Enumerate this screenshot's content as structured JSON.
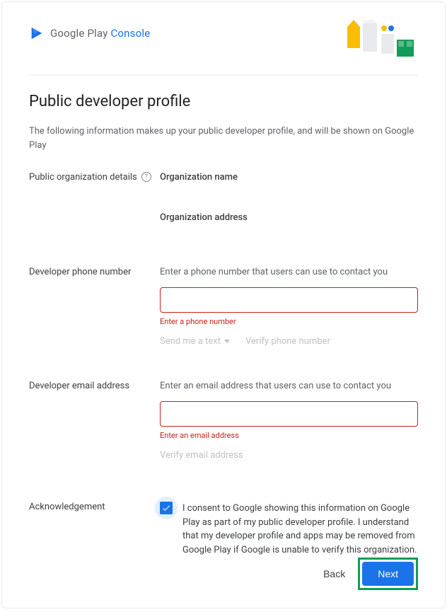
{
  "header": {
    "logo_brand": "Google Play",
    "logo_product": " Console"
  },
  "page": {
    "title": "Public developer profile",
    "description": "The following information makes up your public developer profile, and will be shown on Google Play"
  },
  "org": {
    "section_label": "Public organization details",
    "name_label": "Organization name",
    "address_label": "Organization address"
  },
  "phone": {
    "section_label": "Developer phone number",
    "hint": "Enter a phone number that users can use to contact you",
    "value": "",
    "error": "Enter a phone number",
    "send_text": "Send me a text",
    "verify": "Verify phone number"
  },
  "email": {
    "section_label": "Developer email address",
    "hint": "Enter an email address that users can use to contact you",
    "value": "",
    "error": "Enter an email address",
    "verify": "Verify email address"
  },
  "ack": {
    "section_label": "Acknowledgement",
    "consent": "I consent to Google showing this information on Google Play as part of my public developer profile. I understand that my developer profile and apps may be removed from Google Play if Google is unable to verify this organization.",
    "checked": true
  },
  "footer": {
    "back": "Back",
    "next": "Next"
  }
}
